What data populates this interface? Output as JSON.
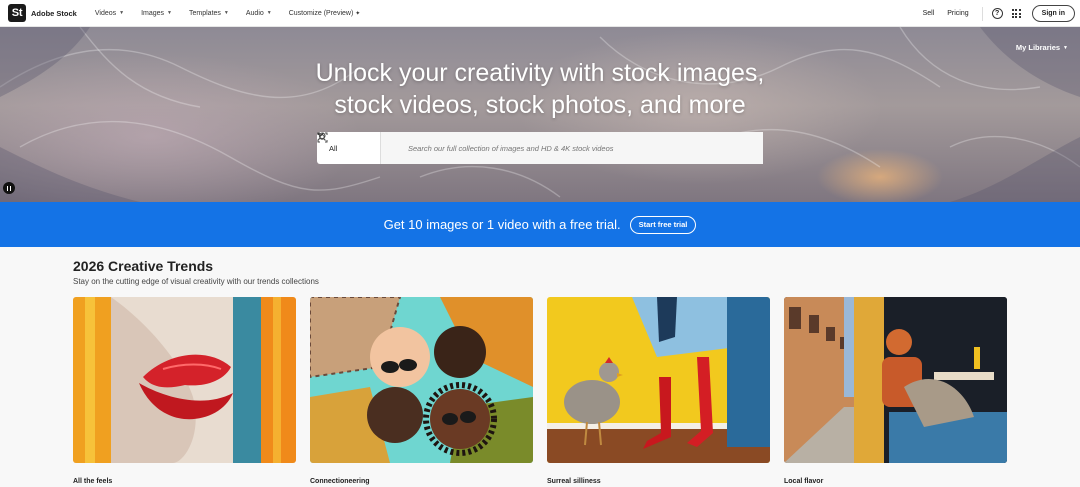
{
  "brand": {
    "logo_letters": "St",
    "name": "Adobe Stock"
  },
  "nav": {
    "items": [
      {
        "label": "Videos",
        "caret": "⌄"
      },
      {
        "label": "Images",
        "caret": "⌄"
      },
      {
        "label": "Templates",
        "caret": "⌄"
      },
      {
        "label": "Audio",
        "caret": "⌄"
      },
      {
        "label": "Customize (Preview)",
        "caret": ""
      }
    ],
    "customize_spark": "✦",
    "sell": "Sell",
    "pricing": "Pricing",
    "help_icon": "?",
    "signin": "Sign in"
  },
  "hero": {
    "title_line1": "Unlock your creativity with stock images,",
    "title_line2": "stock videos, stock photos, and more",
    "my_libraries": "My Libraries",
    "search": {
      "scope": "All",
      "placeholder": "Search our full collection of images and HD & 4K stock videos"
    }
  },
  "banner": {
    "text": "Get 10 images or 1 video with a free trial.",
    "button": "Start free trial",
    "color": "#1473e6"
  },
  "trends": {
    "title": "2026 Creative Trends",
    "subtitle": "Stay on the cutting edge of visual creativity with our trends collections",
    "cards": [
      {
        "label": "All the feels"
      },
      {
        "label": "Connectioneering"
      },
      {
        "label": "Surreal silliness"
      },
      {
        "label": "Local flavor"
      }
    ]
  }
}
